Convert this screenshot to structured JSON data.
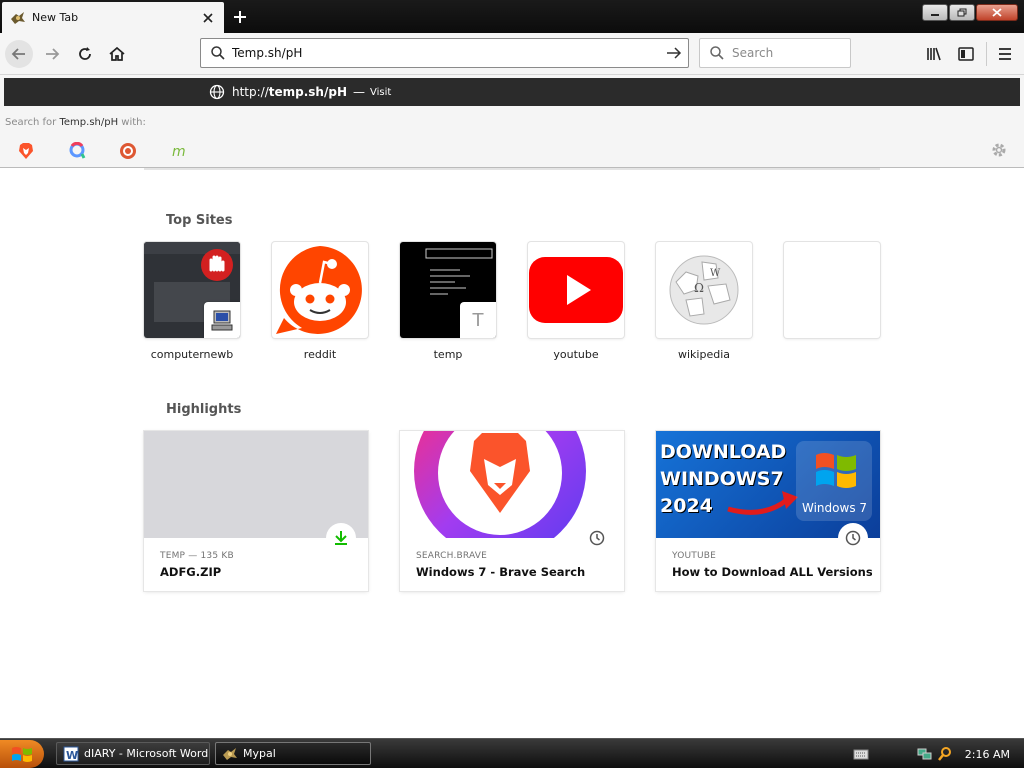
{
  "tab": {
    "title": "New Tab"
  },
  "navbar": {
    "url_value": "Temp.sh/pH",
    "search_placeholder": "Search"
  },
  "dropdown": {
    "suggest_scheme": "http://",
    "suggest_host": "temp.sh/pH",
    "suggest_dash": "—",
    "suggest_action": "Visit",
    "search_for_prefix": "Search for",
    "search_for_query": "Temp.sh/pH",
    "search_for_suffix": "with:",
    "engines": [
      "brave-icon",
      "qwant-icon",
      "duckduckgo-icon",
      "mojeek-icon"
    ]
  },
  "top_sites": {
    "title": "Top Sites",
    "items": [
      {
        "label": "computernewb"
      },
      {
        "label": "reddit"
      },
      {
        "label": "temp",
        "mini": "T"
      },
      {
        "label": "youtube"
      },
      {
        "label": "wikipedia"
      },
      {
        "label": ""
      }
    ]
  },
  "highlights": {
    "title": "Highlights",
    "items": [
      {
        "source": "TEMP — 135 KB",
        "title": "ADFG.ZIP"
      },
      {
        "source": "SEARCH.BRAVE",
        "title": "Windows 7 - Brave Search"
      },
      {
        "source": "YOUTUBE",
        "title": "How to Download ALL Versions ...",
        "thumb_line1": "DOWNLOAD",
        "thumb_line2": "WINDOWS7",
        "thumb_line3": "2024",
        "thumb_logo": "Windows 7"
      }
    ]
  },
  "taskbar": {
    "tasks": [
      {
        "label": "dIARY - Microsoft Word"
      },
      {
        "label": "Mypal"
      }
    ],
    "clock": "2:16 AM"
  },
  "colors": {
    "accent": "#0a84ff",
    "download_green": "#12bc00",
    "youtube_red": "#ff0000",
    "reddit_orange": "#ff4500"
  }
}
